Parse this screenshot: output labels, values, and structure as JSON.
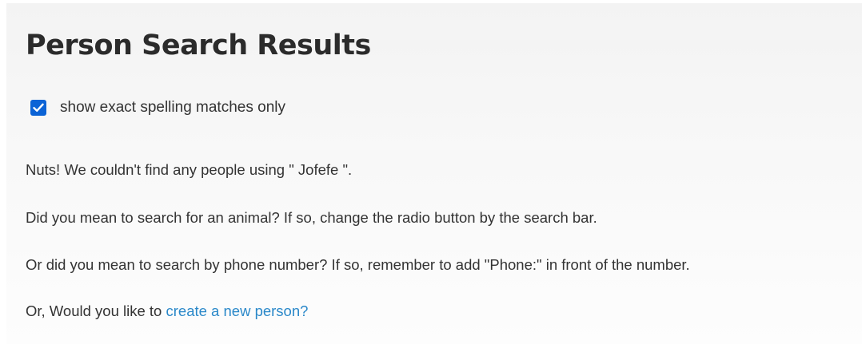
{
  "page": {
    "title": "Person Search Results"
  },
  "filter": {
    "exact_label": "show exact spelling matches only",
    "exact_checked": true
  },
  "messages": {
    "not_found": "Nuts! We couldn't find any people using \" Jofefe \".",
    "animal_hint": "Did you mean to search for an animal? If so, change the radio button by the search bar.",
    "phone_hint": "Or did you mean to search by phone number? If so, remember to add \"Phone:\" in front of the number.",
    "create_prefix": "Or, Would you like to ",
    "create_link": "create a new person?"
  },
  "colors": {
    "accent": "#0b63d6",
    "link": "#2a88c9",
    "text": "#333333"
  }
}
